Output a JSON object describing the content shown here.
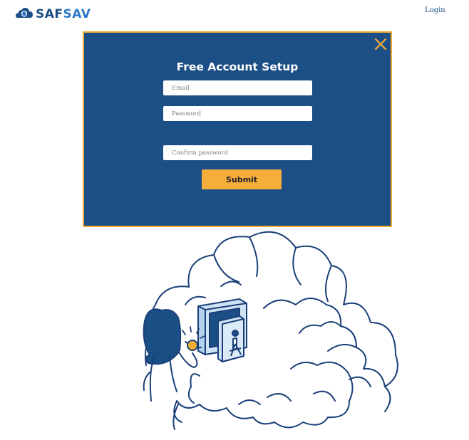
{
  "header": {
    "logo_part1": "SAF",
    "logo_part2": "SAV",
    "login_label": "Login"
  },
  "modal": {
    "title": "Free Account Setup",
    "email_placeholder": "Email",
    "password_placeholder": "Password",
    "confirm_placeholder": "Confirm password",
    "submit_label": "Submit",
    "close_icon": "close-icon"
  },
  "colors": {
    "brand_navy": "#1b4f85",
    "accent_orange": "#f4ad33",
    "logo_light_blue": "#2f78c9",
    "safe_light_blue": "#cfe3f5"
  },
  "icons": {
    "logo": "shield-cloud-logo-icon",
    "illustration": "person-saving-coin-in-cloud-safe-illustration"
  }
}
